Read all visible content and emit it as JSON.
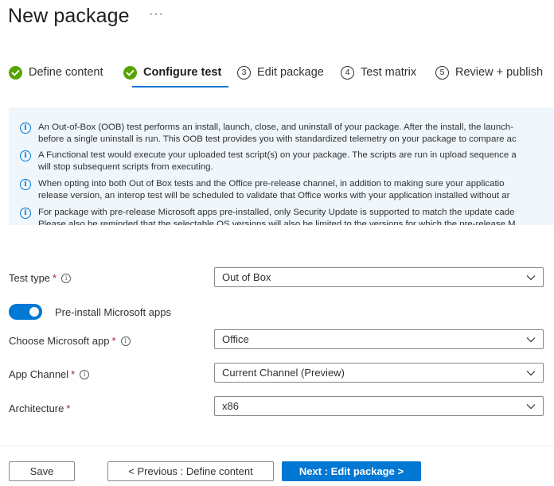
{
  "page": {
    "title": "New package",
    "more_label": "···"
  },
  "steps": [
    {
      "label": "Define content",
      "status": "complete"
    },
    {
      "label": "Configure test",
      "status": "complete",
      "active": true
    },
    {
      "number": "3",
      "label": "Edit package",
      "status": "pending"
    },
    {
      "number": "4",
      "label": "Test matrix",
      "status": "pending"
    },
    {
      "number": "5",
      "label": "Review + publish",
      "status": "pending"
    }
  ],
  "info": {
    "lines": [
      "An Out-of-Box (OOB) test performs an install, launch, close, and uninstall of your package. After the install, the launch-",
      "before a single uninstall is run. This OOB test provides you with standardized telemetry on your package to compare ac",
      "A Functional test would execute your uploaded test script(s) on your package. The scripts are run in upload sequence a",
      "will stop subsequent scripts from executing.",
      "When opting into both Out of Box tests and the Office pre-release channel, in addition to making sure your applicatio",
      "release version, an interop test will be scheduled to validate that Office works with your application installed without ar",
      "For package with pre-release Microsoft apps pre-installed, only Security Update is supported to match the update cade",
      "Please also be reminded that the selectable OS versions will also be limited to the versions for which the pre-release M"
    ]
  },
  "form": {
    "test_type": {
      "label": "Test type",
      "required": "*",
      "value": "Out of Box"
    },
    "preinstall": {
      "label": "Pre-install Microsoft apps",
      "on": true
    },
    "microsoft_app": {
      "label": "Choose Microsoft app",
      "required": "*",
      "value": "Office"
    },
    "app_channel": {
      "label": "App Channel",
      "required": "*",
      "value": "Current Channel (Preview)"
    },
    "architecture": {
      "label": "Architecture",
      "required": "*",
      "value": "x86"
    }
  },
  "footer": {
    "save_label": "Save",
    "prev_label": "< Previous : Define content",
    "next_label": "Next : Edit package >"
  },
  "colors": {
    "accent": "#0078d4",
    "success": "#57a300",
    "info_bg": "#eff6fc",
    "required": "#a4262c"
  },
  "icons": {
    "complete": "check-circle-icon",
    "info": "info-icon",
    "help": "help-icon",
    "dropdown": "chevron-down-icon",
    "more": "ellipsis-icon"
  }
}
